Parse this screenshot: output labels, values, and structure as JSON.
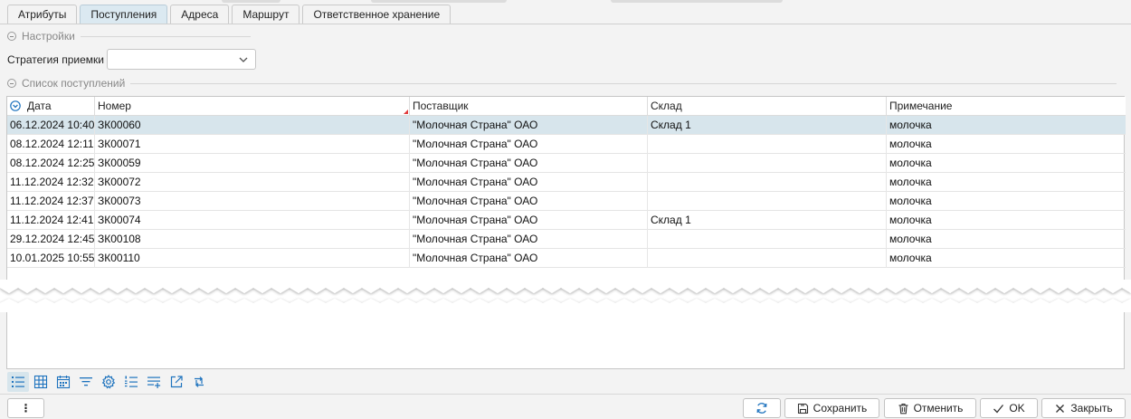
{
  "tabs": [
    {
      "label": "Атрибуты",
      "active": false
    },
    {
      "label": "Поступления",
      "active": true
    },
    {
      "label": "Адреса",
      "active": false
    },
    {
      "label": "Маршрут",
      "active": false
    },
    {
      "label": "Ответственное хранение",
      "active": false
    }
  ],
  "settings": {
    "group_title": "Настройки",
    "strategy_label": "Стратегия приемки",
    "strategy_value": ""
  },
  "receipts": {
    "group_title": "Список поступлений",
    "columns": [
      "Дата",
      "Номер",
      "Поставщик",
      "Склад",
      "Примечание"
    ],
    "rows": [
      {
        "date": "06.12.2024 10:40",
        "number": "ЗК00060",
        "supplier": "\"Молочная Страна\" ОАО",
        "warehouse": "Склад 1",
        "note": "молочка",
        "selected": true
      },
      {
        "date": "08.12.2024 12:11",
        "number": "ЗК00071",
        "supplier": "\"Молочная Страна\" ОАО",
        "warehouse": "",
        "note": "молочка"
      },
      {
        "date": "08.12.2024 12:25",
        "number": "ЗК00059",
        "supplier": "\"Молочная Страна\" ОАО",
        "warehouse": "",
        "note": "молочка"
      },
      {
        "date": "11.12.2024 12:32",
        "number": "ЗК00072",
        "supplier": "\"Молочная Страна\" ОАО",
        "warehouse": "",
        "note": "молочка"
      },
      {
        "date": "11.12.2024 12:37",
        "number": "ЗК00073",
        "supplier": "\"Молочная Страна\" ОАО",
        "warehouse": "",
        "note": "молочка"
      },
      {
        "date": "11.12.2024 12:41",
        "number": "ЗК00074",
        "supplier": "\"Молочная Страна\" ОАО",
        "warehouse": "Склад 1",
        "note": "молочка"
      },
      {
        "date": "29.12.2024 12:45",
        "number": "ЗК00108",
        "supplier": "\"Молочная Страна\" ОАО",
        "warehouse": "",
        "note": "молочка"
      },
      {
        "date": "10.01.2025 10:55",
        "number": "ЗК00110",
        "supplier": "\"Молочная Страна\" ОАО",
        "warehouse": "",
        "note": "молочка"
      }
    ]
  },
  "toolbar_icons": [
    "list-view-icon",
    "grid-view-icon",
    "calendar-view-icon",
    "filter-icon",
    "settings-gear-icon",
    "numbered-list-icon",
    "add-row-icon",
    "open-external-icon",
    "swap-icon"
  ],
  "footer": {
    "more_label": "⋮",
    "save_label": "Сохранить",
    "cancel_label": "Отменить",
    "ok_label": "OK",
    "close_label": "Закрыть"
  },
  "colors": {
    "accent": "#1e73be",
    "selected_row": "#d7e5ec",
    "active_tab": "#dbe9f1",
    "mark_red": "#e23b3b"
  }
}
